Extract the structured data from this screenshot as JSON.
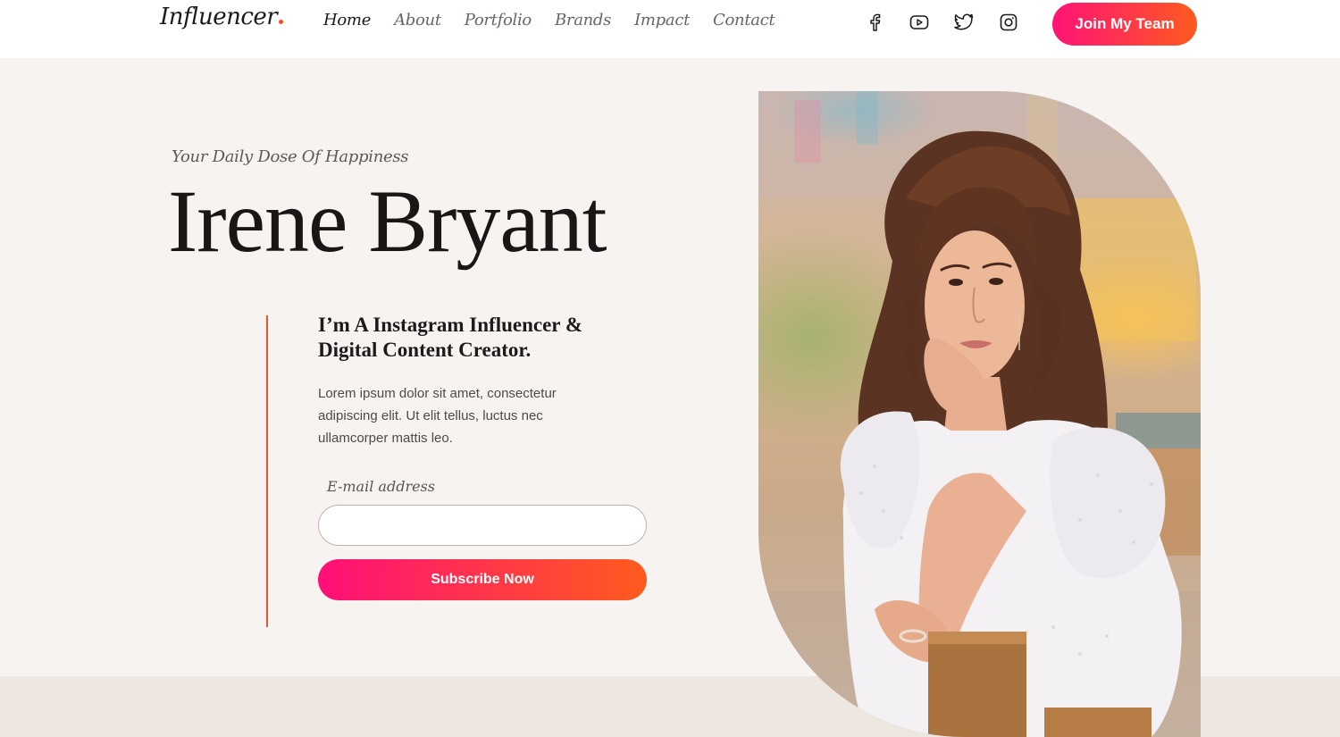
{
  "header": {
    "logo": "Influencer",
    "nav": [
      {
        "label": "Home",
        "active": true
      },
      {
        "label": "About",
        "active": false
      },
      {
        "label": "Portfolio",
        "active": false
      },
      {
        "label": "Brands",
        "active": false
      },
      {
        "label": "Impact",
        "active": false
      },
      {
        "label": "Contact",
        "active": false
      }
    ],
    "social_icons": [
      "facebook-icon",
      "youtube-icon",
      "twitter-icon",
      "instagram-icon"
    ],
    "cta_label": "Join My Team"
  },
  "hero": {
    "tagline": "Your Daily Dose Of Happiness",
    "name": "Irene Bryant",
    "intro_heading": "I’m A Instagram Influencer & Digital Content Creator.",
    "intro_body": "Lorem ipsum dolor sit amet, consectetur adipiscing elit. Ut elit tellus, luctus nec ullamcorper mattis leo.",
    "email_label": "E-mail address",
    "email_value": "",
    "subscribe_label": "Subscribe Now"
  },
  "colors": {
    "accent_start": "#ff1377",
    "accent_end": "#ff5a1f",
    "page_bg": "#f7f3f0",
    "divider": "#e0582f"
  }
}
